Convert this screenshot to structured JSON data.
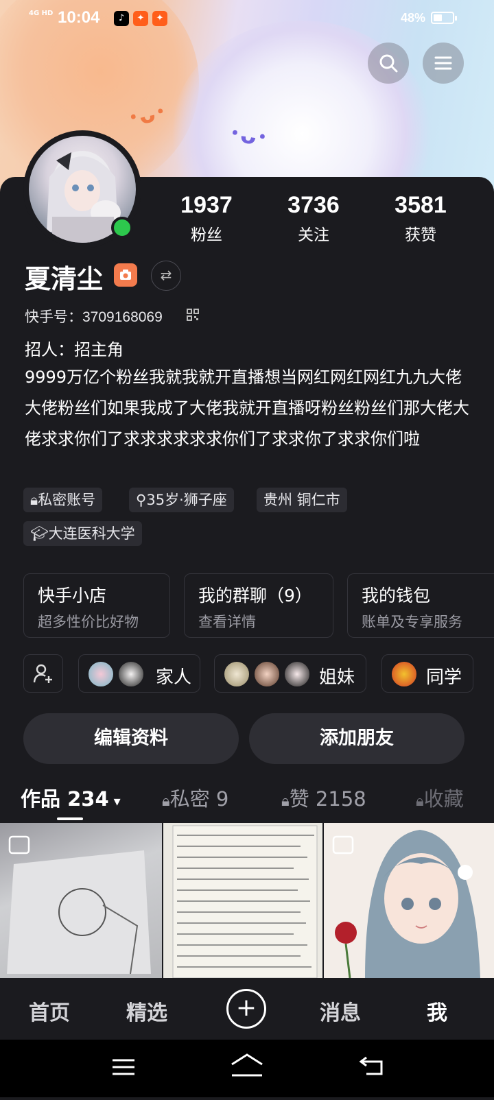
{
  "status_bar": {
    "network": "4G HD",
    "time": "10:04",
    "battery": "48%",
    "battery_level": 0.48,
    "app_icons": [
      "douyin-icon",
      "kuaishou-icon",
      "kuaishou-icon"
    ]
  },
  "header": {
    "search_icon": "search-icon",
    "menu_icon": "hamburger-menu-icon"
  },
  "profile": {
    "stats": [
      {
        "value": "1937",
        "label": "粉丝"
      },
      {
        "value": "3736",
        "label": "关注"
      },
      {
        "value": "3581",
        "label": "获赞"
      }
    ],
    "name": "夏清尘",
    "kuaishou_id_label": "快手号：3709168069",
    "recruit": "招人：招主角",
    "bio": "9999万亿个粉丝我就我就开直播想当网红网红网红九九大佬大佬粉丝们如果我成了大佬我就开直播呀粉丝粉丝们那大佬大佬求求你们了求求求求求求你们了求求你了求求你们啦",
    "tags": [
      "私密账号",
      "35岁·狮子座",
      "贵州 铜仁市",
      "大连医科大学"
    ]
  },
  "cards": [
    {
      "title": "快手小店",
      "subtitle": "超多性价比好物"
    },
    {
      "title": "我的群聊（9）",
      "subtitle": "查看详情"
    },
    {
      "title": "我的钱包",
      "subtitle": "账单及专享服务"
    }
  ],
  "groups": [
    {
      "label": "家人"
    },
    {
      "label": "姐妹"
    },
    {
      "label": "同学"
    }
  ],
  "actions": {
    "edit_profile": "编辑资料",
    "add_friend": "添加朋友"
  },
  "tabs": [
    {
      "label": "作品 234"
    },
    {
      "label": "私密 9"
    },
    {
      "label": "赞 2158"
    },
    {
      "label": "收藏"
    }
  ],
  "bottom_nav": [
    {
      "label": "首页"
    },
    {
      "label": "精选"
    },
    {
      "label": "消息"
    },
    {
      "label": "我"
    }
  ],
  "colors": {
    "background": "#1b1b1f",
    "online": "#2dc84d",
    "badge": "#f37b4d"
  }
}
